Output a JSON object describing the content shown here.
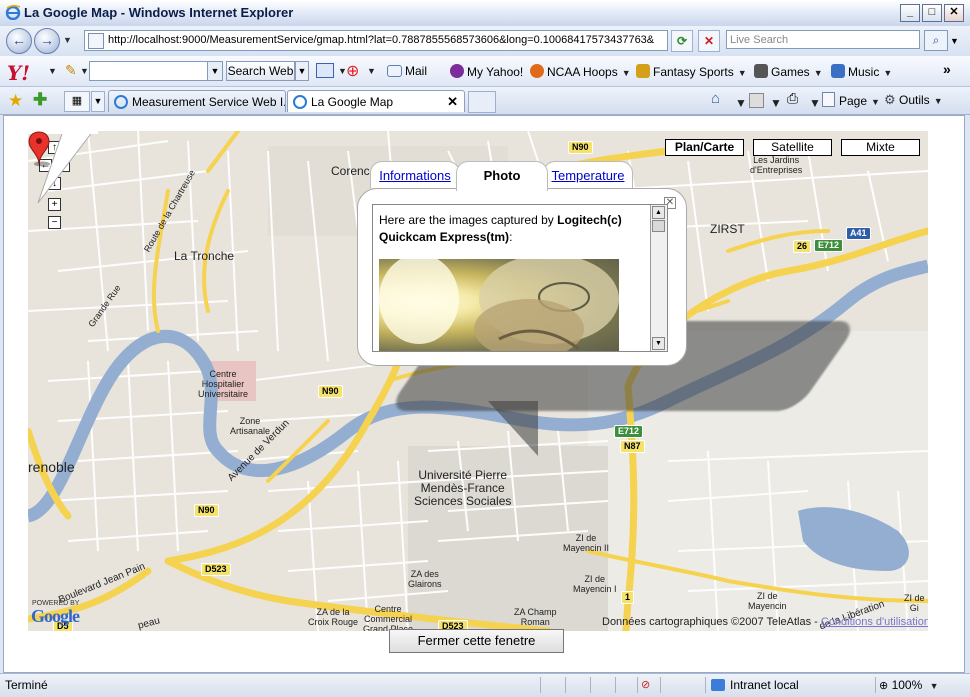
{
  "window": {
    "title": "La Google Map - Windows Internet Explorer",
    "minimize": "_",
    "maximize": "□",
    "close": "✕"
  },
  "address_bar": {
    "url": "http://localhost:9000/MeasurementService/gmap.html?lat=0.7887855568573606&long=0.10068417573437763&",
    "search_placeholder": "Live Search"
  },
  "yahoo_toolbar": {
    "logo": "Y!",
    "search_button": "Search Web",
    "items": [
      "Mail",
      "My Yahoo!",
      "NCAA Hoops",
      "Fantasy Sports",
      "Games",
      "Music"
    ],
    "overflow": "»"
  },
  "tabs": [
    {
      "label": "Measurement Service Web I...",
      "active": false
    },
    {
      "label": "La Google Map",
      "active": true,
      "close": "✕"
    }
  ],
  "command_bar": {
    "page": "Page",
    "tools": "Outils"
  },
  "map": {
    "map_types": [
      {
        "label": "Plan/Carte",
        "selected": true
      },
      {
        "label": "Satellite",
        "selected": false
      },
      {
        "label": "Mixte",
        "selected": false
      }
    ],
    "labels": {
      "corenc": "Corenc",
      "la_tronche": "La Tronche",
      "zirst": "ZIRST",
      "jardins": "Les Jardins\nd'Entreprises",
      "grenoble": "renoble",
      "chu": "Centre\nHospitalier\nUniversitaire",
      "zone_artisanale": "Zone\nArtisanale",
      "universite": "Université Pierre\nMendès-France\nSciences Sociales",
      "avenue_verdun": "Avenue de Verdun",
      "route_chartreuse": "Route de la Chartreuse",
      "grande_rue": "Grande Rue",
      "bd_jean_pain": "Boulevard Jean Pain",
      "za_glairons": "ZA des\nGlairons",
      "za_croix_rouge": "ZA de la\nCroix Rouge",
      "centre_commercial": "Centre\nCommercial\nGrand Place",
      "za_champ_roman": "ZA Champ\nRoman",
      "zi_mayencin_2": "ZI de\nMayencin II",
      "zi_mayencin_1": "ZI de\nMayencin I",
      "zi_mayencin": "ZI de\nMayencin",
      "la_liberation": "de la Libération",
      "zi_gi": "ZI de\nGi",
      "peau": "peau"
    },
    "shields": {
      "n90_top": "N90",
      "n90_mid": "N90",
      "n90_low": "N90",
      "n87": "N87",
      "e712_top": "E712",
      "e712_mid": "E712",
      "a41": "A41",
      "r26": "26",
      "d523_left": "D523",
      "d523_right": "D523",
      "d5": "D5",
      "r1": "1"
    },
    "powered_by": "POWERED BY",
    "google_logo": "Google",
    "copyright": "Données cartographiques ©2007 TeleAtlas - ",
    "terms_link": "Conditions d'utilisation"
  },
  "info_window": {
    "tabs": [
      {
        "label": "Informations",
        "selected": false
      },
      {
        "label": "Photo",
        "selected": true
      },
      {
        "label": "Temperature",
        "selected": false
      }
    ],
    "close": "✕",
    "text_prefix": "Here are the images captured by ",
    "device": "Logitech(c) Quickcam Express(tm)",
    "text_suffix": ":"
  },
  "close_window_button": "Fermer cette fenetre",
  "status_bar": {
    "status": "Terminé",
    "zone": "Intranet local",
    "zoom": "100%"
  },
  "colors": {
    "map_bg": "#e8e4dc",
    "water": "#94aed1",
    "major_road": "#f5d350",
    "minor_road": "#ffffff",
    "link": "#0000cc"
  }
}
